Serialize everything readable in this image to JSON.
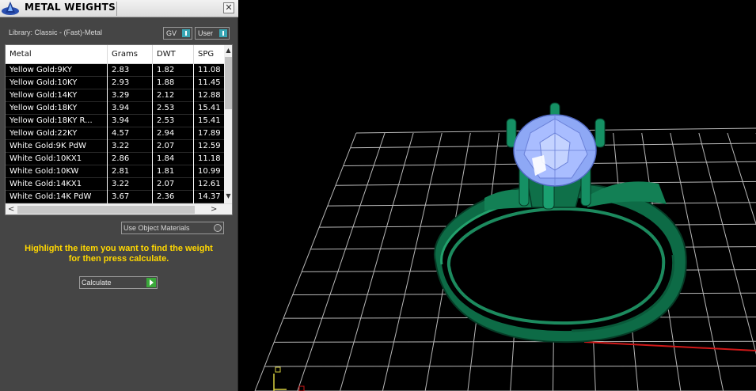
{
  "window": {
    "title": "METAL WEIGHTS",
    "close_glyph": "✕"
  },
  "library": {
    "label": "Library: Classic - (Fast)-Metal"
  },
  "toggles": {
    "gv": "GV",
    "user": "User"
  },
  "table": {
    "headers": [
      "Metal",
      "Grams",
      "DWT",
      "SPG"
    ],
    "rows": [
      {
        "metal": "Yellow Gold:9KY",
        "grams": "2.83",
        "dwt": "1.82",
        "spg": "11.08"
      },
      {
        "metal": "Yellow Gold:10KY",
        "grams": "2.93",
        "dwt": "1.88",
        "spg": "11.45"
      },
      {
        "metal": "Yellow Gold:14KY",
        "grams": "3.29",
        "dwt": "2.12",
        "spg": "12.88"
      },
      {
        "metal": "Yellow Gold:18KY",
        "grams": "3.94",
        "dwt": "2.53",
        "spg": "15.41"
      },
      {
        "metal": "Yellow Gold:18KY R...",
        "grams": "3.94",
        "dwt": "2.53",
        "spg": "15.41"
      },
      {
        "metal": "Yellow Gold:22KY",
        "grams": "4.57",
        "dwt": "2.94",
        "spg": "17.89"
      },
      {
        "metal": "White Gold:9K PdW",
        "grams": "3.22",
        "dwt": "2.07",
        "spg": "12.59"
      },
      {
        "metal": "White Gold:10KX1",
        "grams": "2.86",
        "dwt": "1.84",
        "spg": "11.18"
      },
      {
        "metal": "White Gold:10KW",
        "grams": "2.81",
        "dwt": "1.81",
        "spg": "10.99"
      },
      {
        "metal": "White Gold:14KX1",
        "grams": "3.22",
        "dwt": "2.07",
        "spg": "12.61"
      },
      {
        "metal": "White Gold:14K PdW",
        "grams": "3.67",
        "dwt": "2.36",
        "spg": "14.37"
      }
    ]
  },
  "scroll": {
    "up": "▲",
    "down": "▼",
    "left": "<",
    "right": ">"
  },
  "options": {
    "use_object_materials": "Use Object Materials"
  },
  "instructions": {
    "line1": "Highlight the item you want to find the weight",
    "line2": "for then press calculate."
  },
  "actions": {
    "calculate": "Calculate"
  },
  "colors": {
    "panel_bg": "#454545",
    "highlight_text": "#ffd700",
    "ring_metal": "#11704a",
    "gemstone": "#9db4ff",
    "grid": "#b8b8b8",
    "axis_y": "#1aa3c4",
    "axis_x": "#d01818"
  },
  "icons": {
    "app_logo": "matrix-logo-icon",
    "close": "close-icon",
    "calculate_play": "play-arrow-icon",
    "axis_gizmo": "axis-gizmo-icon"
  }
}
